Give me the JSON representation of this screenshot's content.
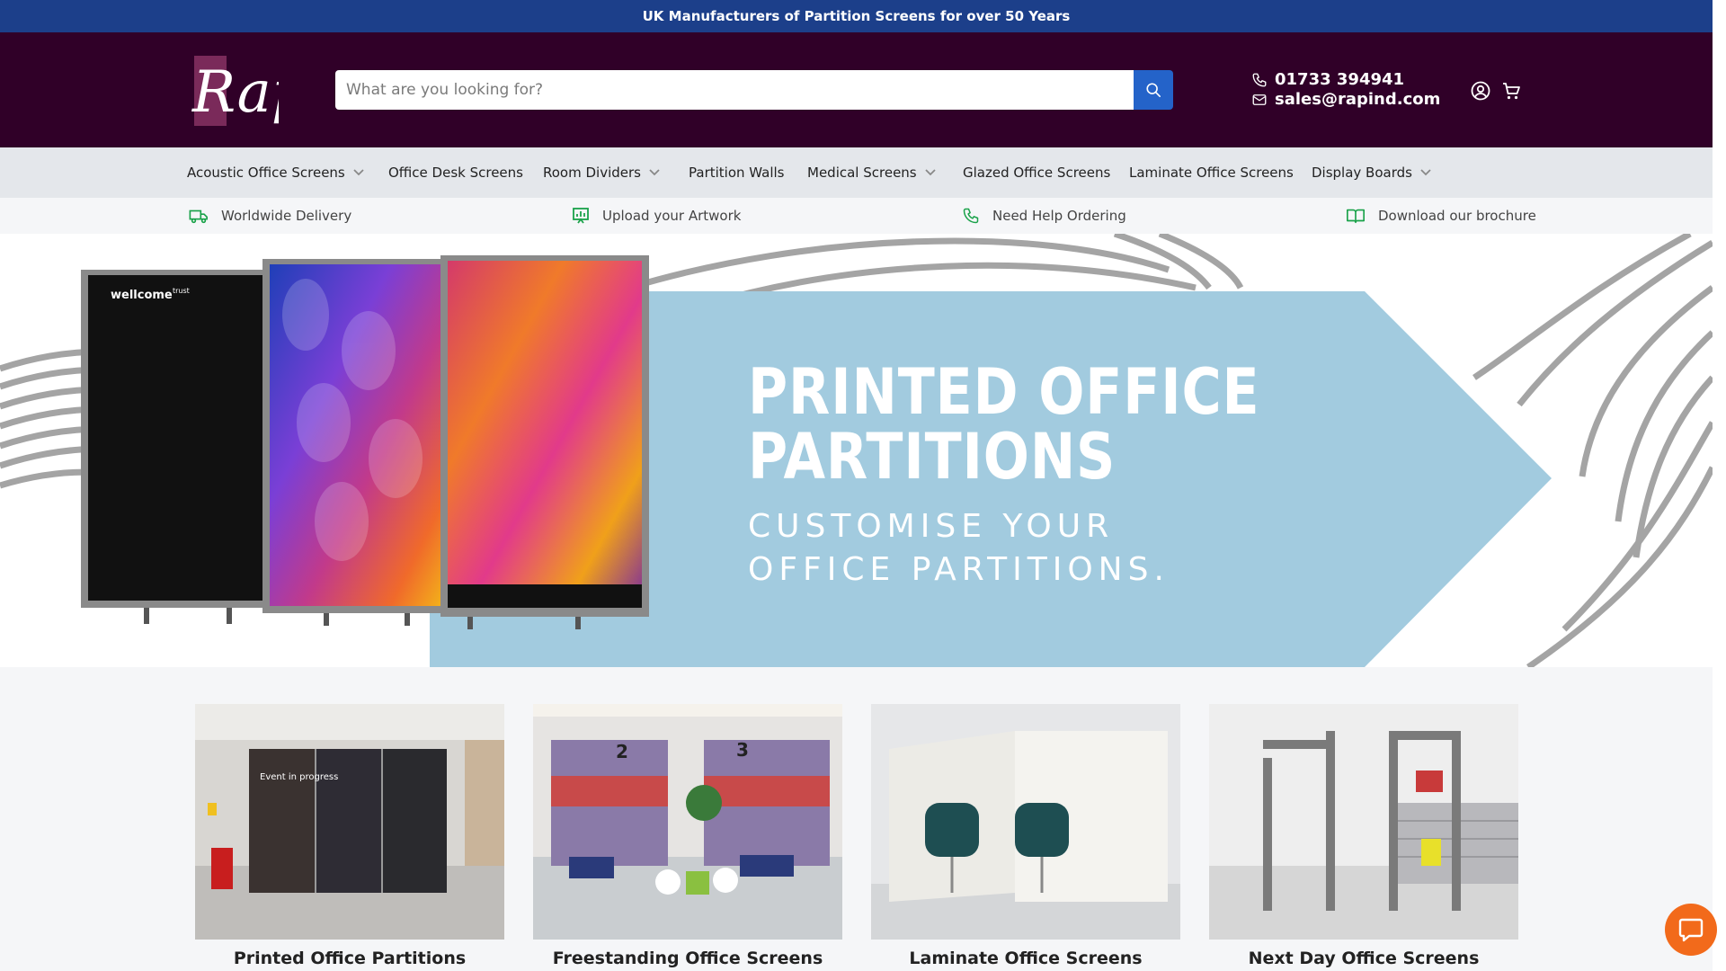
{
  "announcement": "UK Manufacturers of Partition Screens for over 50 Years",
  "header": {
    "logo_text": "Rap",
    "search_placeholder": "What are you looking for?",
    "phone": "01733 394941",
    "email": "sales@rapind.com",
    "icons": [
      "search-icon",
      "phone-icon",
      "mail-icon",
      "account-icon",
      "cart-icon"
    ]
  },
  "nav": {
    "items": [
      {
        "label": "Acoustic Office Screens",
        "dropdown": true
      },
      {
        "label": "Office Desk Screens",
        "dropdown": false
      },
      {
        "label": "Room Dividers",
        "dropdown": true
      },
      {
        "label": "Partition Walls",
        "dropdown": false
      },
      {
        "label": "Medical Screens",
        "dropdown": true
      },
      {
        "label": "Glazed Office Screens",
        "dropdown": false
      },
      {
        "label": "Laminate Office Screens",
        "dropdown": false
      },
      {
        "label": "Display Boards",
        "dropdown": true
      }
    ]
  },
  "usp": {
    "items": [
      {
        "label": "Worldwide Delivery",
        "icon": "truck-icon"
      },
      {
        "label": "Upload your Artwork",
        "icon": "artwork-icon"
      },
      {
        "label": "Need Help Ordering",
        "icon": "phone-icon"
      },
      {
        "label": "Download our brochure",
        "icon": "book-icon"
      }
    ]
  },
  "hero": {
    "title_line1": "PRINTED OFFICE",
    "title_line2": "PARTITIONS",
    "subtitle_line1": "CUSTOMISE YOUR",
    "subtitle_line2": "OFFICE PARTITIONS.",
    "panel_brand": "wellcome",
    "panel_brand_suffix": "trust"
  },
  "cards": [
    {
      "title": "Printed Office Partitions",
      "panel_text": "Event in progress"
    },
    {
      "title": "Freestanding Office Screens",
      "numbers": [
        "2",
        "3"
      ]
    },
    {
      "title": "Laminate Office Screens"
    },
    {
      "title": "Next Day Office Screens"
    }
  ],
  "colors": {
    "announcement_bg": "#1c3f8a",
    "header_bg": "#300028",
    "search_button": "#2463c9",
    "usp_icon": "#1aa24a",
    "hero_arrow": "#a2cbdf",
    "chat_button": "#f26a1b"
  }
}
